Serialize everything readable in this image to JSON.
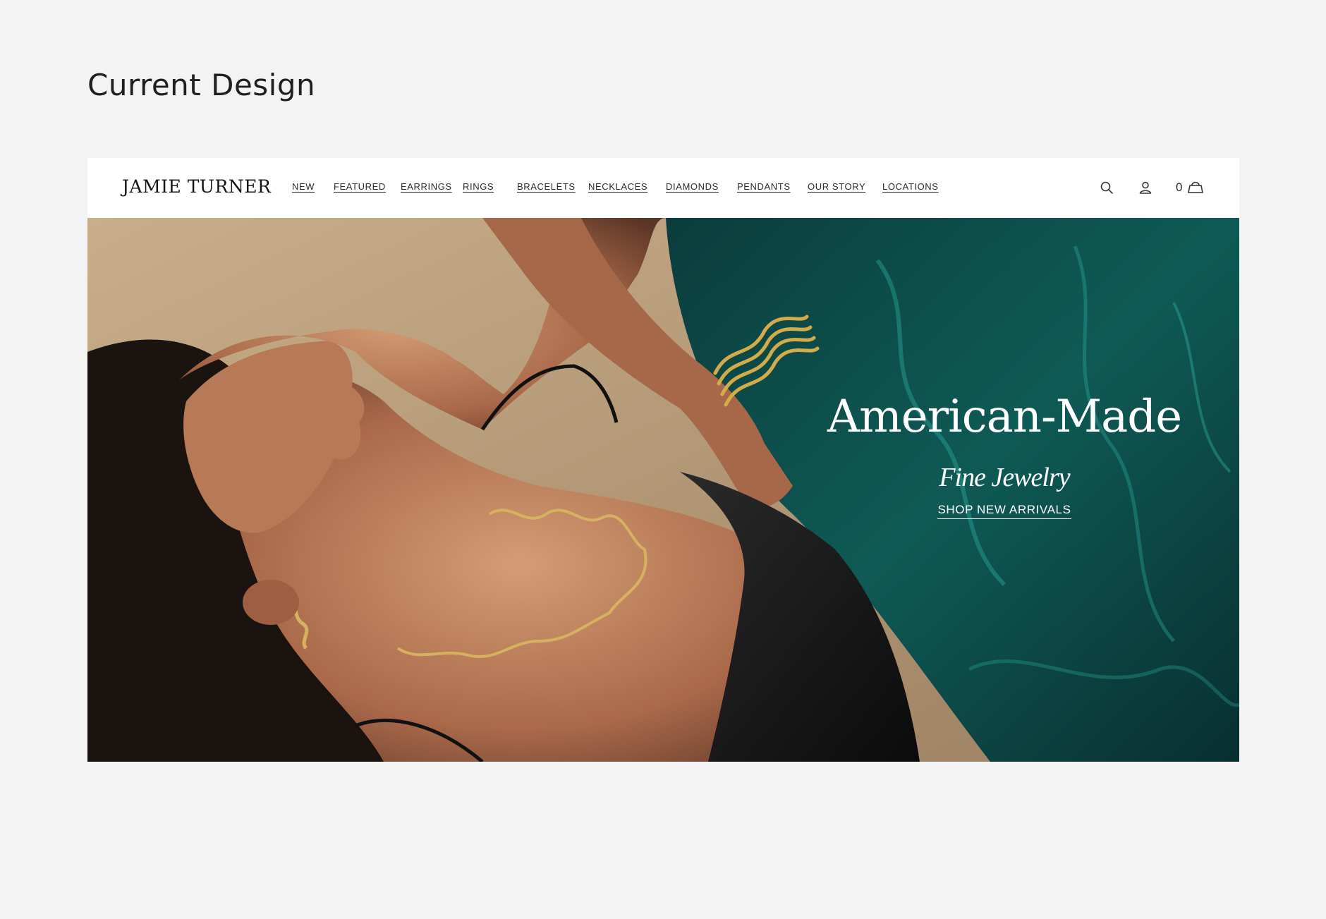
{
  "page": {
    "heading": "Current Design"
  },
  "header": {
    "brand": "JAMIE TURNER",
    "nav": [
      {
        "label": "NEW"
      },
      {
        "label": "FEATURED"
      },
      {
        "label": "EARRINGS"
      },
      {
        "label": "RINGS"
      },
      {
        "label": "BRACELETS"
      },
      {
        "label": "NECKLACES"
      },
      {
        "label": "DIAMONDS"
      },
      {
        "label": "PENDANTS"
      },
      {
        "label": "OUR STORY"
      },
      {
        "label": "LOCATIONS"
      }
    ],
    "icons": {
      "search": "search-icon",
      "account": "user-icon",
      "cart": "bag-icon"
    },
    "cart_count": "0"
  },
  "hero": {
    "title": "American-Made",
    "subtitle": "Fine Jewelry",
    "cta": "SHOP NEW ARRIVALS",
    "colors": {
      "water": "#0d4a48",
      "sand": "#b59a78",
      "skin": "#b87a56",
      "gold": "#c9a24a"
    }
  }
}
